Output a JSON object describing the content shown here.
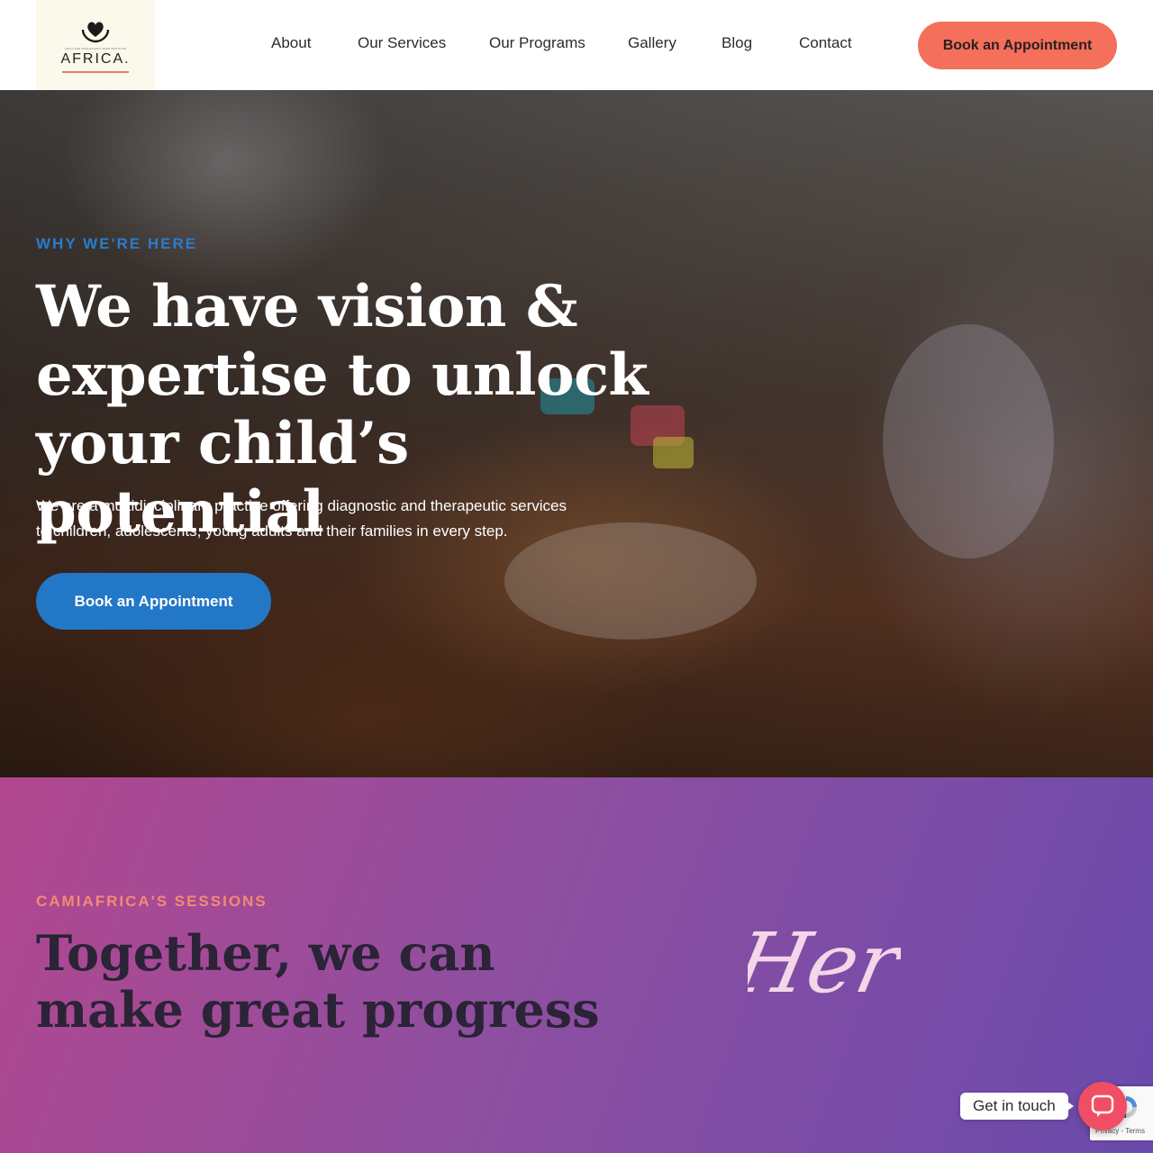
{
  "brand": {
    "logo_small_text": "CHILD AND ADOLESCENT MIND INSTITUTE",
    "logo_word": "AFRICA.",
    "accent": "#f4705a",
    "primary_blue": "#2277c7"
  },
  "nav": {
    "items": [
      {
        "label": "About"
      },
      {
        "label": "Our Services"
      },
      {
        "label": "Our Programs"
      },
      {
        "label": "Gallery"
      },
      {
        "label": "Blog"
      },
      {
        "label": "Contact"
      }
    ],
    "cta_label": "Book an Appointment"
  },
  "hero": {
    "eyebrow": "WHY WE'RE HERE",
    "title": "We have vision & expertise to unlock your child’s potential",
    "subtitle": "We are a multidisciplinary practice offering diagnostic and therapeutic services to children, adolescents, young adults and their families in every step.",
    "cta_label": "Book an Appointment"
  },
  "sessions": {
    "eyebrow": "CAMIAFRICA'S SESSIONS",
    "title": "Together, we can make great progress",
    "script_word": "Her"
  },
  "widgets": {
    "get_in_touch": "Get in touch",
    "chat_icon": "chat-bubble-icon",
    "recaptcha_text": "Privacy - Terms"
  }
}
